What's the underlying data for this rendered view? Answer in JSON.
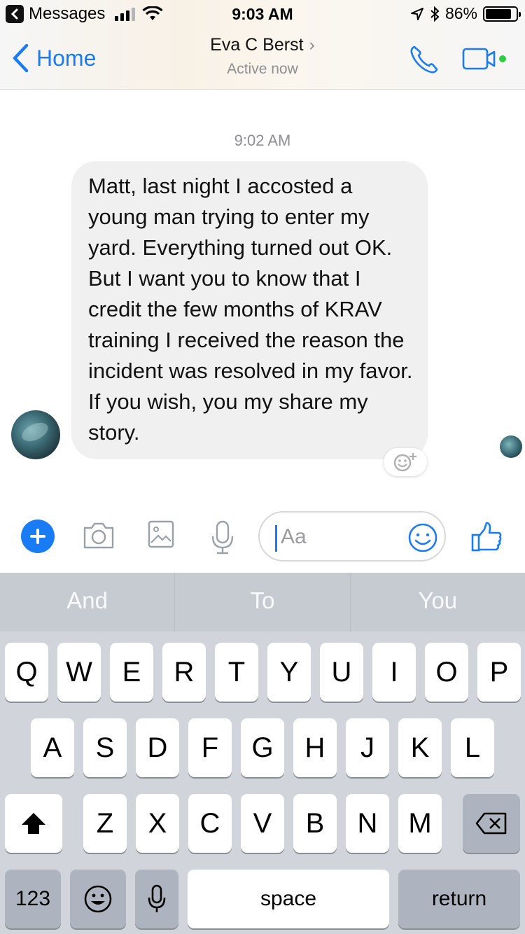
{
  "status_bar": {
    "back_app": "Messages",
    "time": "9:03 AM",
    "battery": "86%",
    "battery_level": 0.86
  },
  "nav": {
    "back_label": "Home",
    "contact_name": "Eva C Berst",
    "chevron": "›",
    "presence": "Active now"
  },
  "conversation": {
    "timestamp": "9:02 AM",
    "message": "Matt, last night I accosted a young man trying to enter my yard. Everything turned out OK. But I want you to know that I credit the few months of KRAV training I received the reason the incident was resolved in my favor. If you wish, you my share my story."
  },
  "composer": {
    "placeholder": "Aa"
  },
  "keyboard": {
    "suggestions": [
      "And",
      "To",
      "You"
    ],
    "row1": [
      "Q",
      "W",
      "E",
      "R",
      "T",
      "Y",
      "U",
      "I",
      "O",
      "P"
    ],
    "row2": [
      "A",
      "S",
      "D",
      "F",
      "G",
      "H",
      "J",
      "K",
      "L"
    ],
    "row3": [
      "Z",
      "X",
      "C",
      "V",
      "B",
      "N",
      "M"
    ],
    "numbers_key": "123",
    "space_key": "space",
    "return_key": "return"
  },
  "colors": {
    "accent": "#1a7cf5",
    "bubble": "#f1f0f0",
    "keyboard_bg": "#d1d5db"
  }
}
